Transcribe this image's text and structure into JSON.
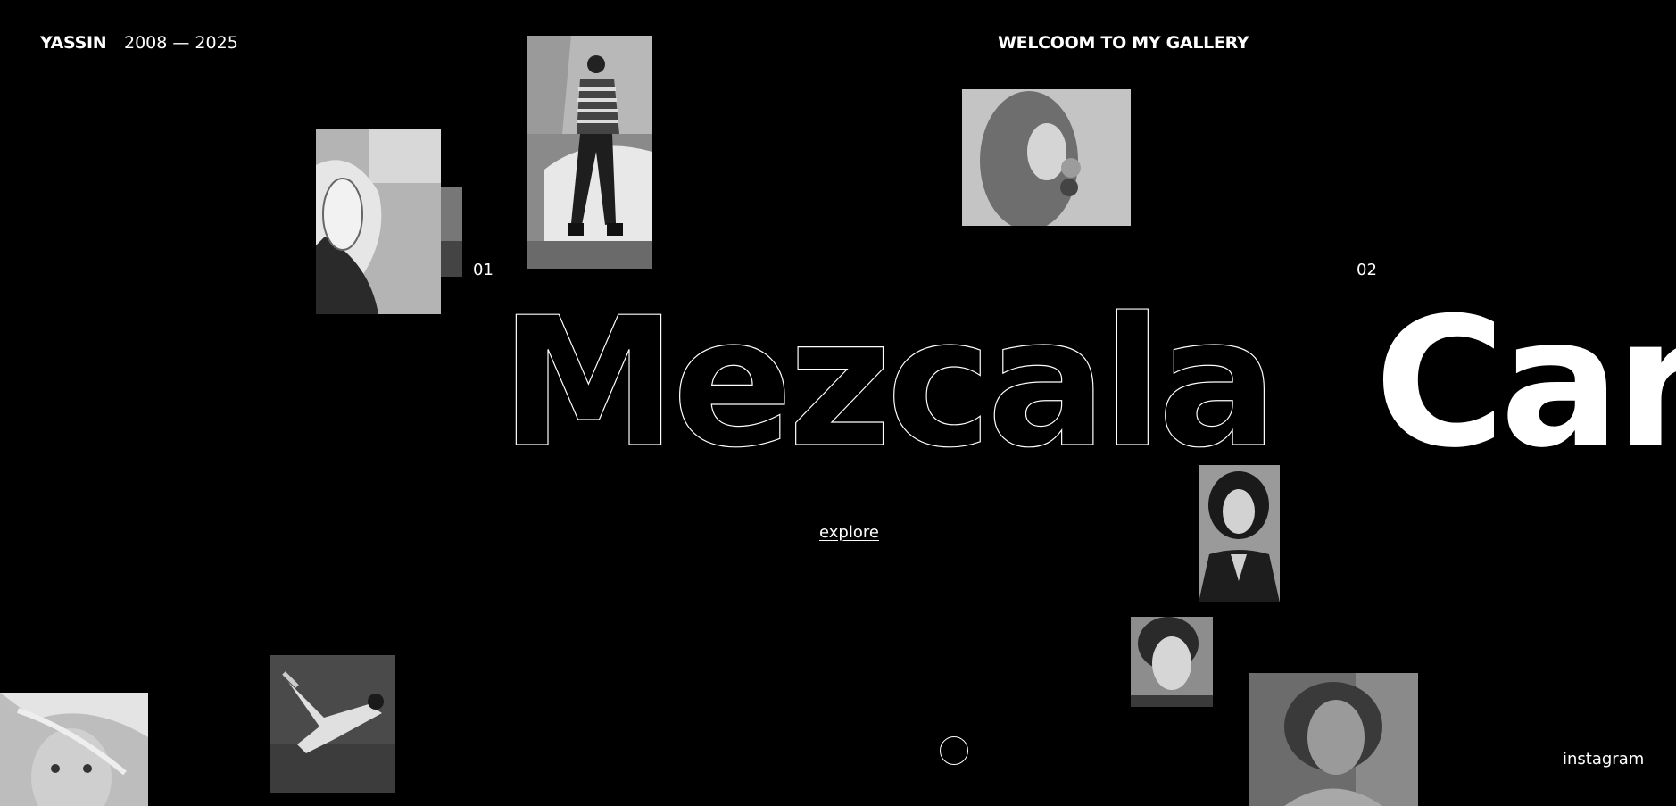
{
  "header": {
    "brand": "YASSIN",
    "years": "2008 — 2025",
    "welcome": "WELCOOM TO MY GALLERY"
  },
  "slides": [
    {
      "index": "01",
      "title": "Mezcala"
    },
    {
      "index": "02",
      "title": "Car"
    }
  ],
  "explore_label": "explore",
  "instagram_label": "instagram",
  "photos": [
    "headphones-portrait",
    "street-fashion-portrait",
    "curly-hair-bubblegum-portrait",
    "short-hair-woman-portrait",
    "woman-closeup-portrait",
    "woman-soft-portrait",
    "lying-woman-photo",
    "freckled-girl-portrait",
    "small-strip-photo"
  ],
  "colors": {
    "background": "#000000",
    "text": "#ffffff"
  }
}
